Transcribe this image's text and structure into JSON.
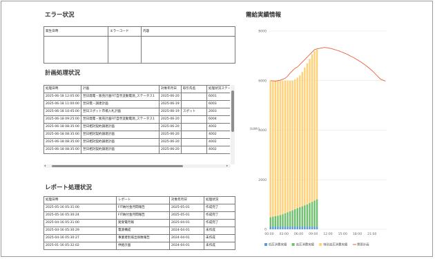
{
  "error_section": {
    "title": "エラー状況",
    "headers": [
      "発生日時",
      "エラーコード",
      "内容"
    ]
  },
  "plan_section": {
    "title": "計画処理状況",
    "headers": [
      "処理日時",
      "計画",
      "対象年月日",
      "取引先名",
      "処理状況ステータス"
    ],
    "rows": [
      [
        "2025-06-18 12:05:00",
        "翌日発電・販売計画FIT自然変動電源_ステータス1",
        "2025-06-20",
        "",
        "6001"
      ],
      [
        "2025-06-18 11:00:00",
        "翌日需・調達計画",
        "2025-06-19",
        "",
        "6003"
      ],
      [
        "2025-06-18 10:45:00",
        "翌日スポット市場入札計画",
        "2025-06-19",
        "スポット",
        "2003"
      ],
      [
        "2025-06-18 09:25:00",
        "翌日発電・販売計画FIT自然変動電源_ステータス1",
        "2025-06-20",
        "",
        "6004"
      ],
      [
        "2025-06-18 08:35:00",
        "翌日相対契約調達計画",
        "2025-06-20",
        "",
        "4002"
      ],
      [
        "2025-06-18 08:35:00",
        "翌日相対契約調達計画",
        "2025-06-20",
        "",
        "4002"
      ],
      [
        "2025-06-18 08:35:00",
        "翌日相対契約調達計画",
        "2025-06-20",
        "",
        "4002"
      ],
      [
        "2025-06-18 08:35:00",
        "翌日相対契約調達計画",
        "2025-06-20",
        "",
        "4002"
      ]
    ]
  },
  "report_section": {
    "title": "レポート処理状況",
    "headers": [
      "処理日時",
      "レポート",
      "対象年月日",
      "処理状況"
    ],
    "rows": [
      [
        "2025-05-16 05:31:00",
        "FIT納付金月間報告",
        "2025-05-01",
        "作成完了"
      ],
      [
        "2025-05-16 05:30:24",
        "FIT納付金月間報告",
        "2025-05-01",
        "作成完了"
      ],
      [
        "2025-04-16 05:31:00",
        "発受電月報",
        "2025-04-01",
        "作成完了"
      ],
      [
        "2025-04-16 05:30:29",
        "電源構成",
        "2024-04-01",
        "未作成"
      ],
      [
        "2025-04-16 05:30:27",
        "事業者別排出係数報告",
        "2024-04-01",
        "未作成"
      ],
      [
        "2025-01-16 05:32:02",
        "供給計画",
        "2024-04-01",
        "未作成"
      ]
    ]
  },
  "chart_section": {
    "title": "需給実績情報",
    "ylabel": "[kWh]"
  },
  "chart_data": {
    "type": "bar",
    "ylim": [
      0,
      8000
    ],
    "yticks": [
      0,
      2000,
      4000,
      6000,
      8000
    ],
    "xticks": [
      "00:00",
      "03:00",
      "06:00",
      "09:00",
      "12:00",
      "15:00",
      "18:00",
      "21:00"
    ],
    "n_slots": 48,
    "bar_slots": 20,
    "series": [
      {
        "name": "低圧消費実績",
        "color": "#5b9bd5",
        "values": [
          110,
          110,
          110,
          110,
          110,
          110,
          110,
          110,
          110,
          110,
          110,
          110,
          110,
          110,
          110,
          110,
          110,
          110,
          110,
          110
        ]
      },
      {
        "name": "高圧消費実績",
        "color": "#70c070",
        "values": [
          380,
          400,
          420,
          440,
          470,
          500,
          540,
          580,
          620,
          660,
          700,
          740,
          780,
          820,
          860,
          900,
          950,
          1000,
          1050,
          1100
        ]
      },
      {
        "name": "特別高圧消費実績",
        "color": "#ffd27a",
        "values": [
          5510,
          5490,
          5470,
          5450,
          5420,
          5390,
          5350,
          5310,
          5270,
          5230,
          5240,
          5270,
          5320,
          5420,
          5560,
          5690,
          5820,
          5960,
          6030,
          6040
        ]
      },
      {
        "name": "需要計画",
        "color": "#e8603c",
        "type": "line",
        "values": [
          6000,
          5990,
          5980,
          6000,
          6020,
          6050,
          6100,
          6180,
          6300,
          6400,
          6500,
          6550,
          6650,
          6750,
          6850,
          6950,
          7050,
          7150,
          7250,
          7280,
          7300,
          7320,
          7340,
          7330,
          7310,
          7290,
          7260,
          7230,
          7200,
          7160,
          7120,
          7080,
          7030,
          6980,
          6930,
          6870,
          6810,
          6750,
          6680,
          6610,
          6530,
          6450,
          6360,
          6260,
          6160,
          6060,
          6020,
          5980
        ]
      }
    ]
  }
}
